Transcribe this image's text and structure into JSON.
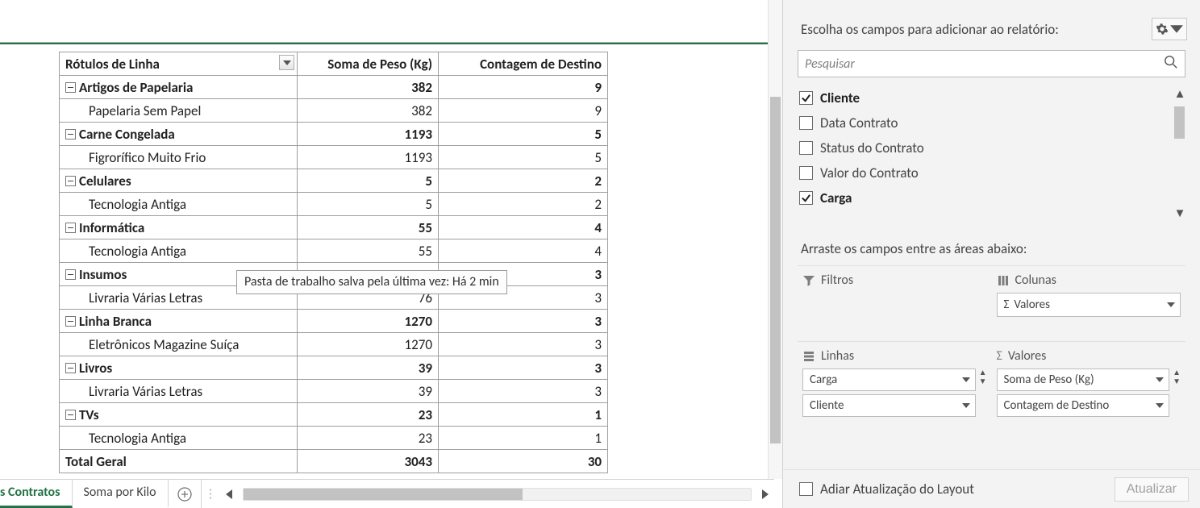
{
  "pivot": {
    "headers": {
      "rows": "Rótulos de Linha",
      "peso": "Soma de Peso (Kg)",
      "dest": "Contagem de Destino"
    },
    "groups": [
      {
        "label": "Artigos de Papelaria",
        "peso": 382,
        "dest": 9,
        "children": [
          {
            "label": "Papelaria Sem Papel",
            "peso": 382,
            "dest": 9
          }
        ]
      },
      {
        "label": "Carne Congelada",
        "peso": 1193,
        "dest": 5,
        "children": [
          {
            "label": "Figrorífico Muito Frio",
            "peso": 1193,
            "dest": 5
          }
        ]
      },
      {
        "label": "Celulares",
        "peso": 5,
        "dest": 2,
        "children": [
          {
            "label": "Tecnologia Antiga",
            "peso": 5,
            "dest": 2
          }
        ]
      },
      {
        "label": "Informática",
        "peso": 55,
        "dest": 4,
        "children": [
          {
            "label": "Tecnologia Antiga",
            "peso": 55,
            "dest": 4
          }
        ]
      },
      {
        "label": "Insumos",
        "peso": null,
        "dest": 3,
        "children": [
          {
            "label": "Livraria Várias Letras",
            "peso": 76,
            "dest": 3
          }
        ]
      },
      {
        "label": "Linha Branca",
        "peso": 1270,
        "dest": 3,
        "children": [
          {
            "label": "Eletrônicos Magazine Suíça",
            "peso": 1270,
            "dest": 3
          }
        ]
      },
      {
        "label": "Livros",
        "peso": 39,
        "dest": 3,
        "children": [
          {
            "label": "Livraria Várias Letras",
            "peso": 39,
            "dest": 3
          }
        ]
      },
      {
        "label": "TVs",
        "peso": 23,
        "dest": 1,
        "children": [
          {
            "label": "Tecnologia Antiga",
            "peso": 23,
            "dest": 1
          }
        ]
      }
    ],
    "total": {
      "label": "Total Geral",
      "peso": 3043,
      "dest": 30
    }
  },
  "tooltip": "Pasta de trabalho salva pela última vez: Há 2 min",
  "tabs": {
    "partial": "s Contratos",
    "second": "Soma por Kilo"
  },
  "pane": {
    "choose": "Escolha os campos para adicionar ao relatório:",
    "search_placeholder": "Pesquisar",
    "fields": [
      {
        "label": "Cliente",
        "checked": true
      },
      {
        "label": "Data Contrato",
        "checked": false
      },
      {
        "label": "Status do Contrato",
        "checked": false
      },
      {
        "label": "Valor do Contrato",
        "checked": false
      },
      {
        "label": "Carga",
        "checked": true
      }
    ],
    "drag": "Arraste os campos entre as áreas abaixo:",
    "areas": {
      "filters": "Filtros",
      "columns": "Colunas",
      "rows": "Linhas",
      "values": "Valores"
    },
    "col_items": [
      "Valores"
    ],
    "row_items": [
      "Carga",
      "Cliente"
    ],
    "val_items": [
      "Soma de Peso (Kg)",
      "Contagem de Destino"
    ],
    "defer": "Adiar Atualização do Layout",
    "update": "Atualizar"
  }
}
